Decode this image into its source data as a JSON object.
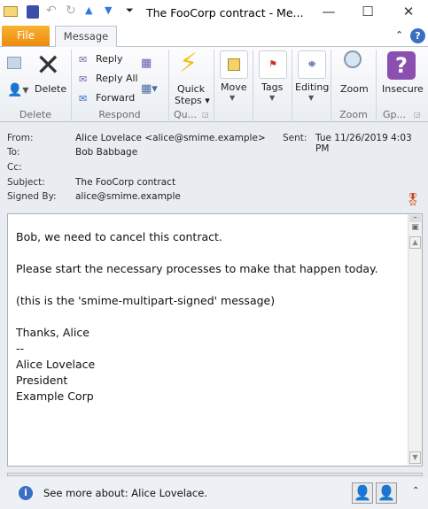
{
  "window": {
    "title": "The FooCorp contract  -  Me...",
    "minimize": "—",
    "maximize": "☐",
    "close": "✕"
  },
  "quick_access": {
    "icons": [
      "mail-icon",
      "save-icon",
      "undo-icon",
      "redo-icon",
      "up-arrow-icon",
      "down-arrow-icon",
      "customize-icon"
    ]
  },
  "tabs": {
    "file": "File",
    "message": "Message"
  },
  "ribbon": {
    "delete_group": {
      "label": "Delete",
      "delete": "Delete"
    },
    "respond_group": {
      "label": "Respond",
      "reply": "Reply",
      "reply_all": "Reply All",
      "forward": "Forward"
    },
    "quick_steps_group": {
      "label": "Qu...",
      "button": "Quick",
      "button2": "Steps"
    },
    "move": "Move",
    "tags": "Tags",
    "editing": "Editing",
    "zoom_group": {
      "label": "Zoom",
      "button": "Zoom"
    },
    "gp_group": {
      "label": "Gp...",
      "button": "Insecure"
    }
  },
  "header": {
    "from_label": "From:",
    "from": "Alice Lovelace <alice@smime.example>",
    "sent_label": "Sent:",
    "sent": "Tue 11/26/2019 4:03 PM",
    "to_label": "To:",
    "to": "Bob Babbage",
    "cc_label": "Cc:",
    "subject_label": "Subject:",
    "subject": "The FooCorp contract",
    "signed_label": "Signed By:",
    "signed": "alice@smime.example"
  },
  "body": {
    "lines": [
      "Bob, we need to cancel this contract.",
      "Please start the necessary processes to make that happen today.",
      "(this is the 'smime-multipart-signed' message)",
      "Thanks, Alice",
      "--",
      "Alice Lovelace",
      "President",
      "Example Corp"
    ]
  },
  "footer": {
    "text": "See more about: Alice Lovelace."
  },
  "colors": {
    "file_tab": "#ec8a0c",
    "insecure": "#8a4fb0",
    "info": "#3a6fc4"
  }
}
